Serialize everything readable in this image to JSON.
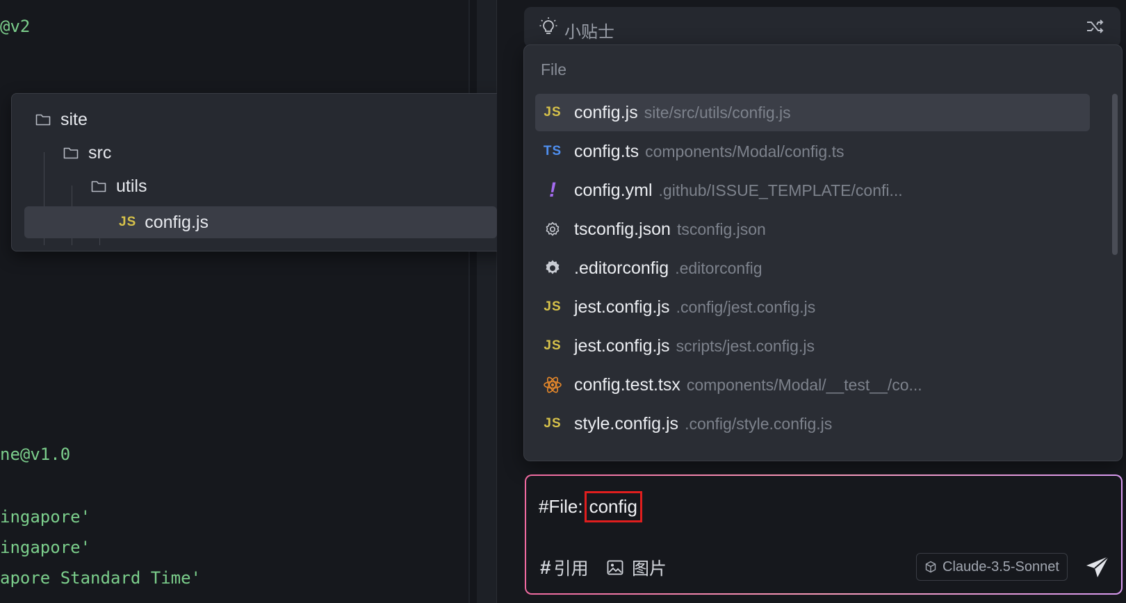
{
  "editor": {
    "lines": [
      "@v2",
      "ne@v1.0",
      "ingapore'",
      "ingapore'",
      "apore Standard Time'"
    ]
  },
  "tree": {
    "items": [
      {
        "label": "site",
        "type": "folder"
      },
      {
        "label": "src",
        "type": "folder"
      },
      {
        "label": "utils",
        "type": "folder"
      },
      {
        "label": "config.js",
        "type": "js",
        "badge": "JS"
      }
    ]
  },
  "tips": {
    "label": "小贴士"
  },
  "dropdown": {
    "header": "File",
    "items": [
      {
        "name": "config.js",
        "path": "site/src/utils/config.js",
        "icon": "js-icon",
        "badge": "JS"
      },
      {
        "name": "config.ts",
        "path": "components/Modal/config.ts",
        "icon": "ts-icon",
        "badge": "TS"
      },
      {
        "name": "config.yml",
        "path": ".github/ISSUE_TEMPLATE/confi...",
        "icon": "yml-icon",
        "badge": "!"
      },
      {
        "name": "tsconfig.json",
        "path": "tsconfig.json",
        "icon": "gear-outline-icon"
      },
      {
        "name": ".editorconfig",
        "path": ".editorconfig",
        "icon": "gear-icon"
      },
      {
        "name": "jest.config.js",
        "path": ".config/jest.config.js",
        "icon": "js-icon",
        "badge": "JS"
      },
      {
        "name": "jest.config.js",
        "path": "scripts/jest.config.js",
        "icon": "js-icon",
        "badge": "JS"
      },
      {
        "name": "config.test.tsx",
        "path": "components/Modal/__test__/co...",
        "icon": "react-icon"
      },
      {
        "name": "style.config.js",
        "path": ".config/style.config.js",
        "icon": "js-icon",
        "badge": "JS"
      }
    ]
  },
  "input": {
    "prefix": "#File:",
    "mention": "config",
    "reference_label": "引用",
    "image_label": "图片",
    "model": "Claude-3.5-Sonnet"
  },
  "colors": {
    "js": "#d7c24a",
    "ts": "#4f8ff0",
    "yml": "#a46bf0",
    "react": "#e8892a",
    "code": "#7ccf8c",
    "highlight": "#e01e1e"
  }
}
